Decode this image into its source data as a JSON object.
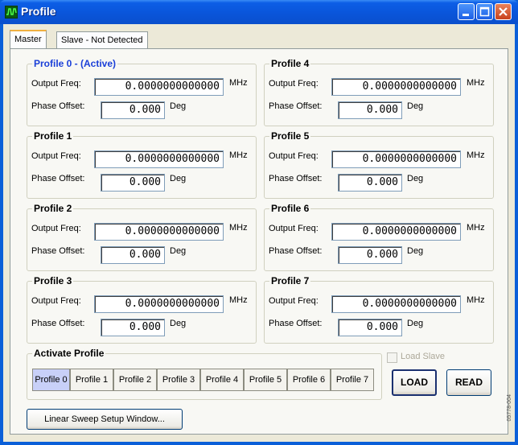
{
  "window": {
    "title": "Profile"
  },
  "tabs": [
    {
      "label": "Master"
    },
    {
      "label": "Slave - Not Detected"
    }
  ],
  "labels": {
    "output_freq": "Output Freq:",
    "phase_offset": "Phase Offset:",
    "mhz": "MHz",
    "deg": "Deg"
  },
  "profiles": [
    {
      "title": "Profile 0 - (Active)",
      "freq": "0.0000000000000",
      "phase": "0.000"
    },
    {
      "title": "Profile 1",
      "freq": "0.0000000000000",
      "phase": "0.000"
    },
    {
      "title": "Profile 2",
      "freq": "0.0000000000000",
      "phase": "0.000"
    },
    {
      "title": "Profile 3",
      "freq": "0.0000000000000",
      "phase": "0.000"
    },
    {
      "title": "Profile 4",
      "freq": "0.0000000000000",
      "phase": "0.000"
    },
    {
      "title": "Profile 5",
      "freq": "0.0000000000000",
      "phase": "0.000"
    },
    {
      "title": "Profile 6",
      "freq": "0.0000000000000",
      "phase": "0.000"
    },
    {
      "title": "Profile 7",
      "freq": "0.0000000000000",
      "phase": "0.000"
    }
  ],
  "activate": {
    "title": "Activate Profile",
    "buttons": [
      "Profile 0",
      "Profile 1",
      "Profile 2",
      "Profile 3",
      "Profile 4",
      "Profile 5",
      "Profile 6",
      "Profile 7"
    ],
    "selected": "Profile 0"
  },
  "load_slave": {
    "label": "Load Slave",
    "checked": false,
    "enabled": false
  },
  "load_button": "LOAD",
  "read_button": "READ",
  "sweep_button": "Linear Sweep Setup Window...",
  "side_code": "05778-004",
  "colors": {
    "titlebar": "#0a55da",
    "active_profile": "#1a3fd8",
    "close_button": "#c9421c",
    "selected_profile_button": "#c8d0f8"
  }
}
